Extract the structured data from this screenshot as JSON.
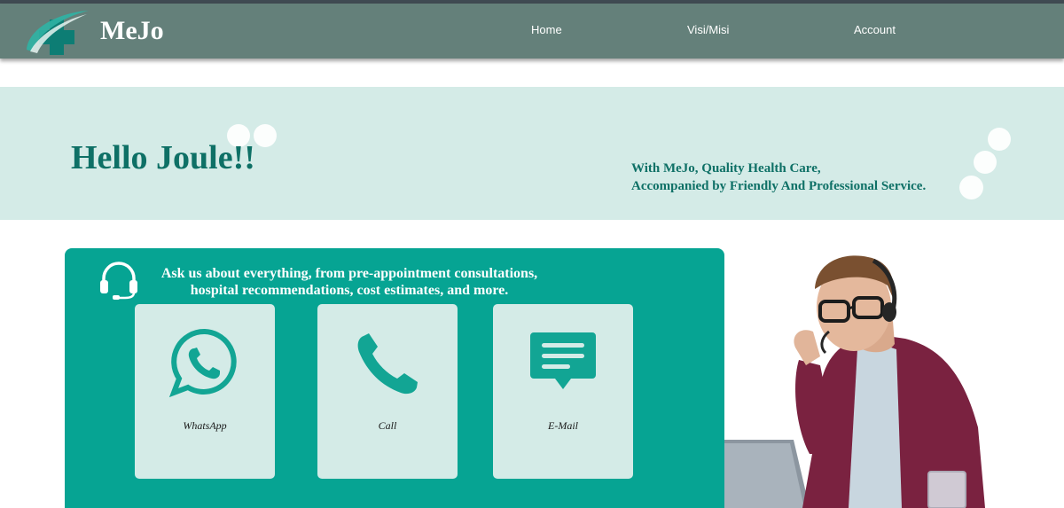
{
  "nav": {
    "brand": "MeJo",
    "links": [
      {
        "label": "Home"
      },
      {
        "label": "Visi/Misi"
      },
      {
        "label": "Account"
      }
    ]
  },
  "hero": {
    "greeting": "Hello Joule!!",
    "tagline_line1": "With MeJo, Quality Health Care,",
    "tagline_line2": "Accompanied by Friendly And Professional Service."
  },
  "contact": {
    "intro_line1": "Ask us about everything, from pre-appointment consultations,",
    "intro_line2": "hospital recommendations, cost estimates, and more.",
    "options": [
      {
        "label": "WhatsApp",
        "icon": "whatsapp-icon"
      },
      {
        "label": "Call",
        "icon": "phone-icon"
      },
      {
        "label": "E-Mail",
        "icon": "message-icon"
      }
    ]
  },
  "colors": {
    "navbar": "#64807a",
    "accent": "#06a493",
    "hero_bg": "#d4ebe7",
    "heading": "#0e7066"
  }
}
